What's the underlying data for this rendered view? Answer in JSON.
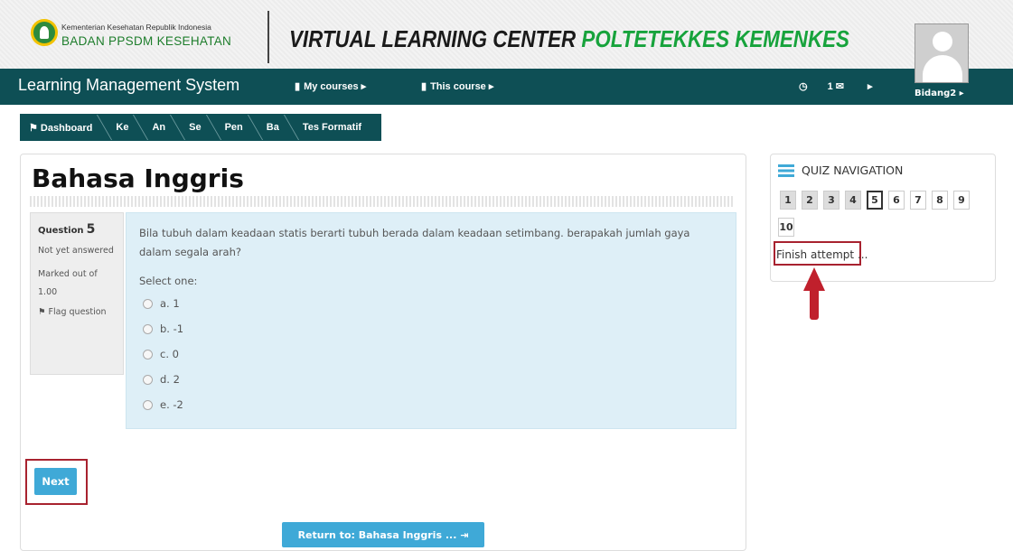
{
  "header": {
    "logo_small": "Kementerian Kesehatan Republik Indonesia",
    "logo_big": "BADAN PPSDM KESEHATAN",
    "title_part1": "VIRTUAL LEARNING CENTER ",
    "title_part2": "POLTETEKKES KEMENKES"
  },
  "navbar": {
    "brand": "Learning Management System",
    "my_courses": "My courses ▸",
    "this_course": "This course ▸",
    "notif_count": "1",
    "menu_caret": "▸",
    "user": "Bidang2 ▸"
  },
  "breadcrumb": [
    "Dashboard",
    "Ke",
    "An",
    "Se",
    "Pen",
    "Ba",
    "Tes Formatif"
  ],
  "page": {
    "title": "Bahasa Inggris"
  },
  "question": {
    "label": "Question",
    "number": "5",
    "status": "Not yet answered",
    "marked": "Marked out of 1.00",
    "flag": "Flag question",
    "text": "Bila tubuh dalam keadaan statis berarti tubuh berada dalam keadaan setimbang. berapakah jumlah gaya dalam segala arah?",
    "select_label": "Select one:",
    "options": [
      "a. 1",
      "b. -1",
      "c. 0",
      "d. 2",
      "e. -2"
    ]
  },
  "buttons": {
    "next": "Next",
    "return": "Return to: Bahasa Inggris ... ⇥"
  },
  "quiz_nav": {
    "title": "QUIZ NAVIGATION",
    "numbers": [
      "1",
      "2",
      "3",
      "4",
      "5",
      "6",
      "7",
      "8",
      "9",
      "10"
    ],
    "finish": "Finish attempt ..."
  },
  "colors": {
    "navbar": "#0e4f55",
    "accent": "#3fa9d7",
    "highlight": "#a8222f",
    "brand_green": "#17a33c"
  }
}
